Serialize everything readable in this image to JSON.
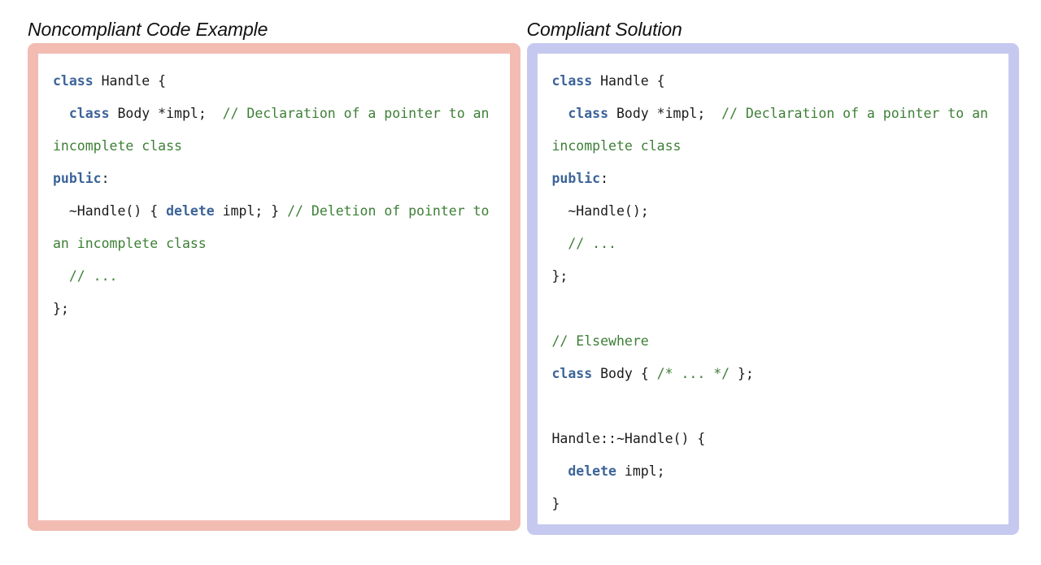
{
  "colors": {
    "page_background": "#ffffff",
    "noncompliant_border": "#f2bcb3",
    "compliant_border": "#c6c9ef",
    "keyword": "#3c6498",
    "comment": "#3d7f36",
    "code_text": "#1b1b1b",
    "heading_text": "#121212"
  },
  "columns": [
    {
      "heading": "Noncompliant Code Example",
      "variant": "noncompliant",
      "code_tokens": [
        [
          {
            "t": "class",
            "c": "kw"
          },
          {
            "t": " Handle {",
            "c": "plain"
          }
        ],
        [
          {
            "t": "  ",
            "c": "plain"
          },
          {
            "t": "class",
            "c": "kw"
          },
          {
            "t": " Body *impl;  ",
            "c": "plain"
          },
          {
            "t": "// Declaration of a pointer to an incomplete class",
            "c": "cmt"
          }
        ],
        [
          {
            "t": "public",
            "c": "kw"
          },
          {
            "t": ":",
            "c": "plain"
          }
        ],
        [
          {
            "t": "  ~Handle() { ",
            "c": "plain"
          },
          {
            "t": "delete",
            "c": "kw"
          },
          {
            "t": " impl; } ",
            "c": "plain"
          },
          {
            "t": "// Deletion of pointer to an incomplete class",
            "c": "cmt"
          }
        ],
        [
          {
            "t": "  ",
            "c": "plain"
          },
          {
            "t": "// ...",
            "c": "cmt"
          }
        ],
        [
          {
            "t": "};",
            "c": "plain"
          }
        ]
      ],
      "code_plain": "class Handle {\n  class Body *impl;  // Declaration of a pointer to an incomplete class\npublic:\n  ~Handle() { delete impl; } // Deletion of pointer to an incomplete class\n  // ...\n};"
    },
    {
      "heading": "Compliant Solution",
      "variant": "compliant",
      "code_tokens": [
        [
          {
            "t": "class",
            "c": "kw"
          },
          {
            "t": " Handle {",
            "c": "plain"
          }
        ],
        [
          {
            "t": "  ",
            "c": "plain"
          },
          {
            "t": "class",
            "c": "kw"
          },
          {
            "t": " Body *impl;  ",
            "c": "plain"
          },
          {
            "t": "// Declaration of a pointer to an incomplete class",
            "c": "cmt"
          }
        ],
        [
          {
            "t": "public",
            "c": "kw"
          },
          {
            "t": ":",
            "c": "plain"
          }
        ],
        [
          {
            "t": "  ~Handle();",
            "c": "plain"
          }
        ],
        [
          {
            "t": "  ",
            "c": "plain"
          },
          {
            "t": "// ...",
            "c": "cmt"
          }
        ],
        [
          {
            "t": "};",
            "c": "plain"
          }
        ],
        [],
        [
          {
            "t": "// Elsewhere",
            "c": "cmt"
          }
        ],
        [
          {
            "t": "class",
            "c": "kw"
          },
          {
            "t": " Body { ",
            "c": "plain"
          },
          {
            "t": "/* ... */",
            "c": "cmt"
          },
          {
            "t": " };",
            "c": "plain"
          }
        ],
        [],
        [
          {
            "t": "Handle::~Handle() {",
            "c": "plain"
          }
        ],
        [
          {
            "t": "  ",
            "c": "plain"
          },
          {
            "t": "delete",
            "c": "kw"
          },
          {
            "t": " impl;",
            "c": "plain"
          }
        ],
        [
          {
            "t": "}",
            "c": "plain"
          }
        ]
      ],
      "code_plain": "class Handle {\n  class Body *impl;  // Declaration of a pointer to an incomplete class\npublic:\n  ~Handle();\n  // ...\n};\n\n// Elsewhere\nclass Body { /* ... */ };\n\nHandle::~Handle() {\n  delete impl;\n}"
    }
  ]
}
